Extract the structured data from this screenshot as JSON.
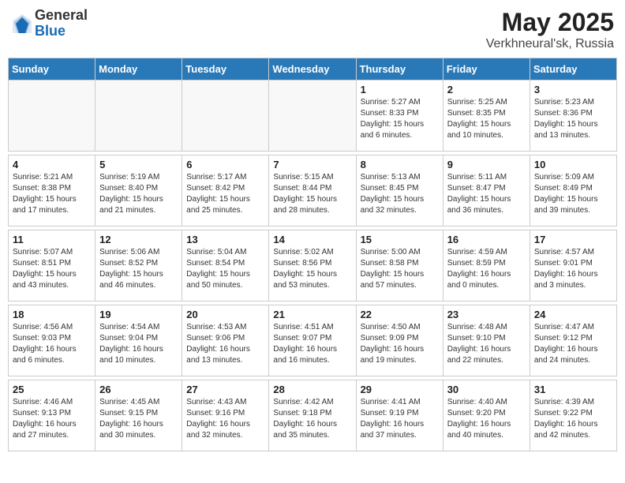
{
  "header": {
    "logo_general": "General",
    "logo_blue": "Blue",
    "month_year": "May 2025",
    "location": "Verkhneural'sk, Russia"
  },
  "weekdays": [
    "Sunday",
    "Monday",
    "Tuesday",
    "Wednesday",
    "Thursday",
    "Friday",
    "Saturday"
  ],
  "weeks": [
    [
      {
        "day": "",
        "info": ""
      },
      {
        "day": "",
        "info": ""
      },
      {
        "day": "",
        "info": ""
      },
      {
        "day": "",
        "info": ""
      },
      {
        "day": "1",
        "info": "Sunrise: 5:27 AM\nSunset: 8:33 PM\nDaylight: 15 hours\nand 6 minutes."
      },
      {
        "day": "2",
        "info": "Sunrise: 5:25 AM\nSunset: 8:35 PM\nDaylight: 15 hours\nand 10 minutes."
      },
      {
        "day": "3",
        "info": "Sunrise: 5:23 AM\nSunset: 8:36 PM\nDaylight: 15 hours\nand 13 minutes."
      }
    ],
    [
      {
        "day": "4",
        "info": "Sunrise: 5:21 AM\nSunset: 8:38 PM\nDaylight: 15 hours\nand 17 minutes."
      },
      {
        "day": "5",
        "info": "Sunrise: 5:19 AM\nSunset: 8:40 PM\nDaylight: 15 hours\nand 21 minutes."
      },
      {
        "day": "6",
        "info": "Sunrise: 5:17 AM\nSunset: 8:42 PM\nDaylight: 15 hours\nand 25 minutes."
      },
      {
        "day": "7",
        "info": "Sunrise: 5:15 AM\nSunset: 8:44 PM\nDaylight: 15 hours\nand 28 minutes."
      },
      {
        "day": "8",
        "info": "Sunrise: 5:13 AM\nSunset: 8:45 PM\nDaylight: 15 hours\nand 32 minutes."
      },
      {
        "day": "9",
        "info": "Sunrise: 5:11 AM\nSunset: 8:47 PM\nDaylight: 15 hours\nand 36 minutes."
      },
      {
        "day": "10",
        "info": "Sunrise: 5:09 AM\nSunset: 8:49 PM\nDaylight: 15 hours\nand 39 minutes."
      }
    ],
    [
      {
        "day": "11",
        "info": "Sunrise: 5:07 AM\nSunset: 8:51 PM\nDaylight: 15 hours\nand 43 minutes."
      },
      {
        "day": "12",
        "info": "Sunrise: 5:06 AM\nSunset: 8:52 PM\nDaylight: 15 hours\nand 46 minutes."
      },
      {
        "day": "13",
        "info": "Sunrise: 5:04 AM\nSunset: 8:54 PM\nDaylight: 15 hours\nand 50 minutes."
      },
      {
        "day": "14",
        "info": "Sunrise: 5:02 AM\nSunset: 8:56 PM\nDaylight: 15 hours\nand 53 minutes."
      },
      {
        "day": "15",
        "info": "Sunrise: 5:00 AM\nSunset: 8:58 PM\nDaylight: 15 hours\nand 57 minutes."
      },
      {
        "day": "16",
        "info": "Sunrise: 4:59 AM\nSunset: 8:59 PM\nDaylight: 16 hours\nand 0 minutes."
      },
      {
        "day": "17",
        "info": "Sunrise: 4:57 AM\nSunset: 9:01 PM\nDaylight: 16 hours\nand 3 minutes."
      }
    ],
    [
      {
        "day": "18",
        "info": "Sunrise: 4:56 AM\nSunset: 9:03 PM\nDaylight: 16 hours\nand 6 minutes."
      },
      {
        "day": "19",
        "info": "Sunrise: 4:54 AM\nSunset: 9:04 PM\nDaylight: 16 hours\nand 10 minutes."
      },
      {
        "day": "20",
        "info": "Sunrise: 4:53 AM\nSunset: 9:06 PM\nDaylight: 16 hours\nand 13 minutes."
      },
      {
        "day": "21",
        "info": "Sunrise: 4:51 AM\nSunset: 9:07 PM\nDaylight: 16 hours\nand 16 minutes."
      },
      {
        "day": "22",
        "info": "Sunrise: 4:50 AM\nSunset: 9:09 PM\nDaylight: 16 hours\nand 19 minutes."
      },
      {
        "day": "23",
        "info": "Sunrise: 4:48 AM\nSunset: 9:10 PM\nDaylight: 16 hours\nand 22 minutes."
      },
      {
        "day": "24",
        "info": "Sunrise: 4:47 AM\nSunset: 9:12 PM\nDaylight: 16 hours\nand 24 minutes."
      }
    ],
    [
      {
        "day": "25",
        "info": "Sunrise: 4:46 AM\nSunset: 9:13 PM\nDaylight: 16 hours\nand 27 minutes."
      },
      {
        "day": "26",
        "info": "Sunrise: 4:45 AM\nSunset: 9:15 PM\nDaylight: 16 hours\nand 30 minutes."
      },
      {
        "day": "27",
        "info": "Sunrise: 4:43 AM\nSunset: 9:16 PM\nDaylight: 16 hours\nand 32 minutes."
      },
      {
        "day": "28",
        "info": "Sunrise: 4:42 AM\nSunset: 9:18 PM\nDaylight: 16 hours\nand 35 minutes."
      },
      {
        "day": "29",
        "info": "Sunrise: 4:41 AM\nSunset: 9:19 PM\nDaylight: 16 hours\nand 37 minutes."
      },
      {
        "day": "30",
        "info": "Sunrise: 4:40 AM\nSunset: 9:20 PM\nDaylight: 16 hours\nand 40 minutes."
      },
      {
        "day": "31",
        "info": "Sunrise: 4:39 AM\nSunset: 9:22 PM\nDaylight: 16 hours\nand 42 minutes."
      }
    ]
  ]
}
